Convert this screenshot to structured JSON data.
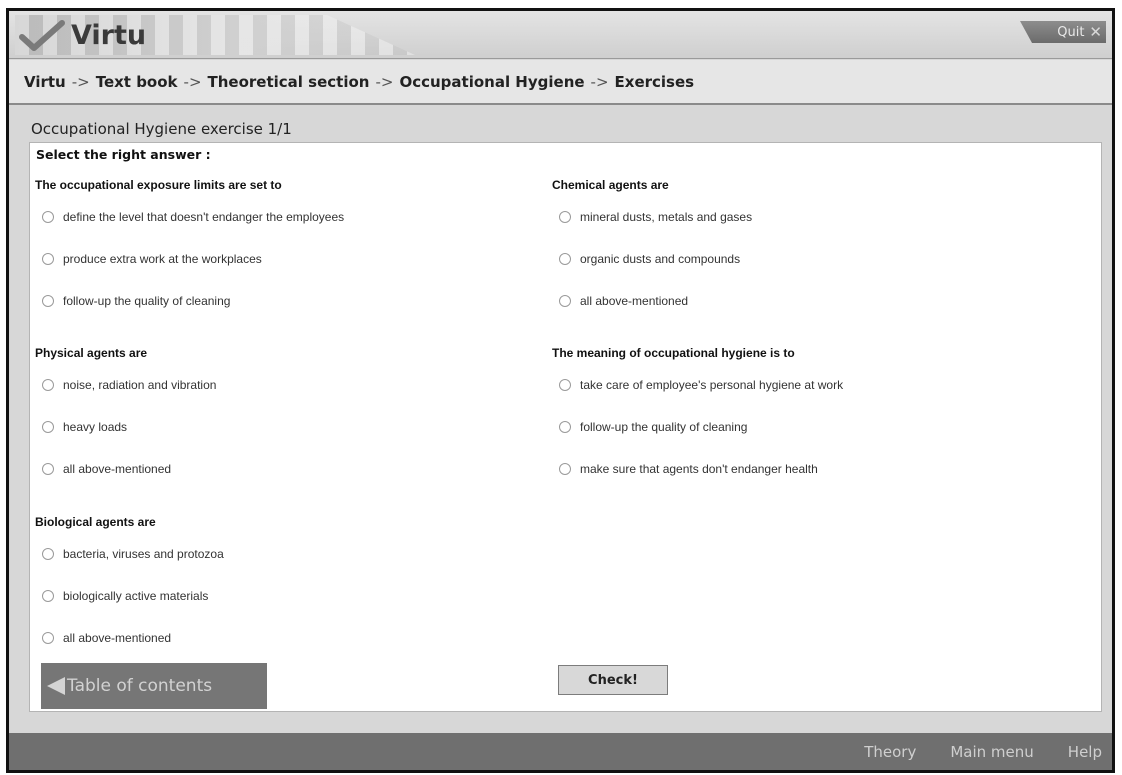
{
  "header": {
    "app_name": "Virtu",
    "quit_label": "Quit",
    "quit_icon": "close-icon"
  },
  "breadcrumb": {
    "items": [
      "Virtu",
      "Text book",
      "Theoretical section",
      "Occupational Hygiene",
      "Exercises"
    ],
    "separator": "->"
  },
  "exercise": {
    "title": "Occupational Hygiene exercise 1/1",
    "instruction": "Select the right answer :",
    "questions": [
      {
        "title": "The occupational exposure limits are set to",
        "options": [
          "define the level that doesn't endanger the employees",
          "produce extra work at the workplaces",
          "follow-up the quality of cleaning"
        ]
      },
      {
        "title": "Physical agents are",
        "options": [
          "noise, radiation and vibration",
          "heavy loads",
          "all above-mentioned"
        ]
      },
      {
        "title": "Biological agents are",
        "options": [
          "bacteria, viruses and protozoa",
          "biologically active materials",
          "all above-mentioned"
        ]
      },
      {
        "title": "Chemical agents are",
        "options": [
          "mineral dusts, metals and gases",
          "organic dusts and compounds",
          "all above-mentioned"
        ]
      },
      {
        "title": "The meaning of occupational hygiene is to",
        "options": [
          "take care of employee's personal hygiene at work",
          "follow-up the quality of cleaning",
          "make sure that agents don't endanger health"
        ]
      }
    ],
    "toc_button": "Table of contents",
    "check_button": "Check!"
  },
  "footer": {
    "links": [
      "Theory",
      "Main menu",
      "Help"
    ]
  },
  "colors": {
    "frame_background": "#d7d7d7",
    "footer_background": "#6f6f6f",
    "toc_button_background": "#767676"
  }
}
